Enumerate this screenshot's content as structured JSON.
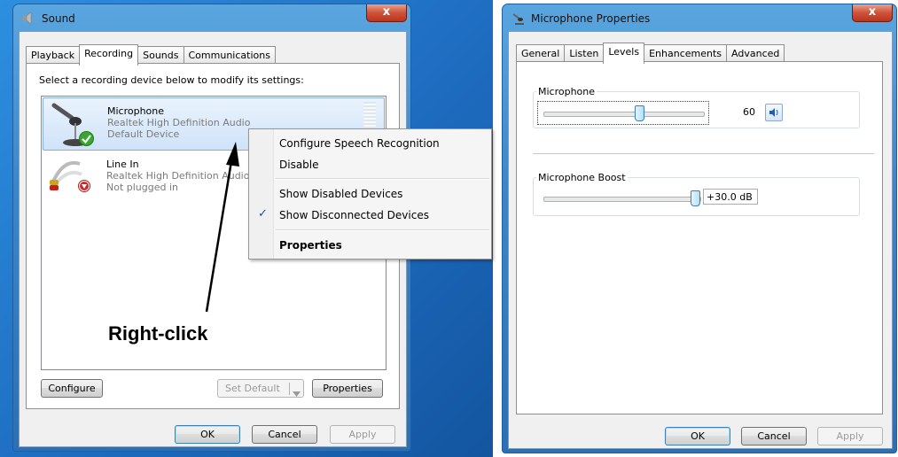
{
  "sound_dialog": {
    "title": "Sound",
    "close_glyph": "x",
    "tabs": [
      "Playback",
      "Recording",
      "Sounds",
      "Communications"
    ],
    "active_tab": "Recording",
    "instruction": "Select a recording device below to modify its settings:",
    "devices": [
      {
        "name": "Microphone",
        "driver": "Realtek High Definition Audio",
        "status": "Default Device",
        "icon": "microphone-icon",
        "badge": "green-check-icon"
      },
      {
        "name": "Line In",
        "driver": "Realtek High Definition Audio",
        "status": "Not plugged in",
        "icon": "line-in-cable-icon",
        "badge": "red-down-arrow-icon"
      }
    ],
    "buttons": {
      "configure": "Configure",
      "set_default": "Set Default",
      "properties": "Properties",
      "ok": "OK",
      "cancel": "Cancel",
      "apply": "Apply"
    }
  },
  "context_menu": {
    "items": [
      {
        "label": "Configure Speech Recognition",
        "checked": false,
        "bold": false
      },
      {
        "label": "Disable",
        "checked": false,
        "bold": false
      },
      {
        "label": "Show Disabled Devices",
        "checked": false,
        "bold": false
      },
      {
        "label": "Show Disconnected Devices",
        "checked": true,
        "bold": false
      },
      {
        "label": "Properties",
        "checked": false,
        "bold": true
      }
    ],
    "check_glyph": "✓"
  },
  "annotation": {
    "label": "Right-click"
  },
  "mic_properties": {
    "title": "Microphone Properties",
    "close_glyph": "x",
    "tabs": [
      "General",
      "Listen",
      "Levels",
      "Enhancements",
      "Advanced"
    ],
    "active_tab": "Levels",
    "microphone_group": {
      "label": "Microphone",
      "value": "60",
      "level_fraction": 0.6,
      "speaker_icon": "speaker-icon"
    },
    "boost_group": {
      "label": "Microphone Boost",
      "value": "+30.0 dB",
      "level_fraction": 1.0
    },
    "buttons": {
      "ok": "OK",
      "cancel": "Cancel",
      "apply": "Apply"
    }
  },
  "colors": {
    "desktop_blue": "#1f6fc4",
    "accent_selection": "#cfe3f9",
    "close_red": "#c7422b"
  }
}
